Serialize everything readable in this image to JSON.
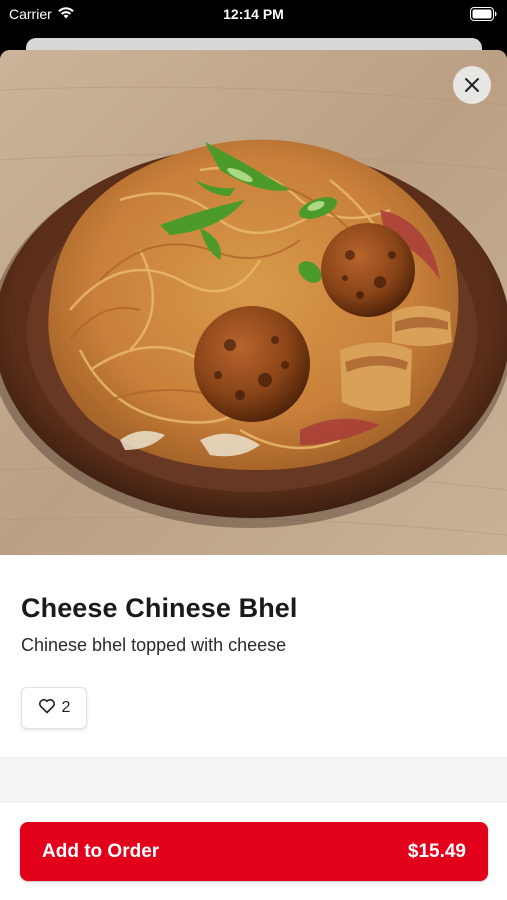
{
  "status_bar": {
    "carrier": "Carrier",
    "time": "12:14 PM"
  },
  "item": {
    "title": "Cheese Chinese Bhel",
    "description": "Chinese bhel topped with cheese",
    "likes": "2"
  },
  "footer": {
    "add_label": "Add to Order",
    "price": "$15.49"
  },
  "icons": {
    "close": "close-icon",
    "heart": "heart-icon",
    "wifi": "wifi-icon",
    "battery": "battery-icon"
  },
  "colors": {
    "accent": "#e3001b",
    "background": "#ffffff"
  }
}
